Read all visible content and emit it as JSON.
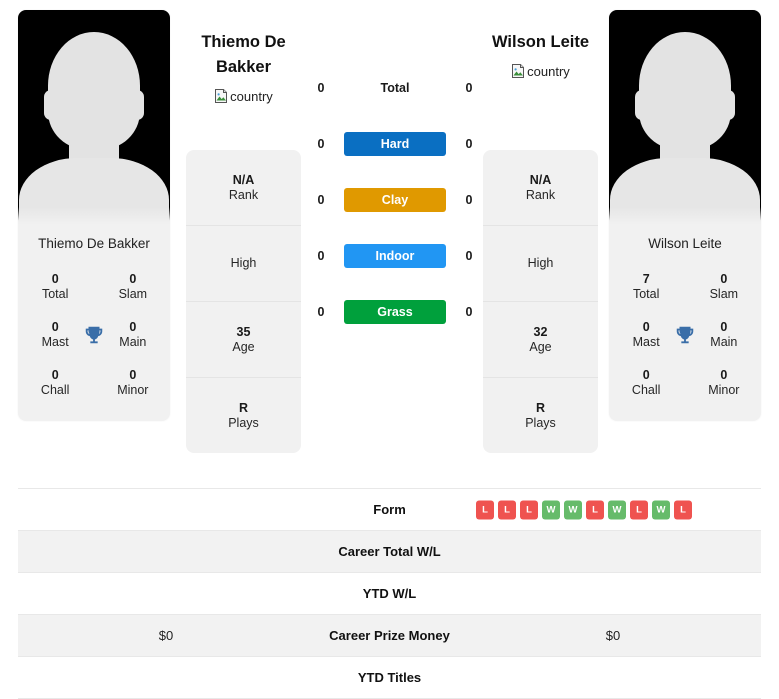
{
  "players": {
    "left": {
      "name": "Thiemo De Bakker",
      "headline": "Thiemo De Bakker",
      "flag_alt": "country",
      "titles": {
        "total_value": "0",
        "total_label": "Total",
        "slam_value": "0",
        "slam_label": "Slam",
        "mast_value": "0",
        "mast_label": "Mast",
        "main_value": "0",
        "main_label": "Main",
        "chall_value": "0",
        "chall_label": "Chall",
        "minor_value": "0",
        "minor_label": "Minor"
      },
      "info": {
        "rank_value": "N/A",
        "rank_label": "Rank",
        "high_value": "",
        "high_label": "High",
        "age_value": "35",
        "age_label": "Age",
        "plays_value": "R",
        "plays_label": "Plays"
      },
      "surfaces": {
        "total": "0",
        "hard": "0",
        "clay": "0",
        "indoor": "0",
        "grass": "0"
      },
      "table": {
        "form": [
          "L",
          "L",
          "L",
          "W",
          "W",
          "L",
          "W",
          "L",
          "W",
          "L"
        ],
        "career_wl": "",
        "ytd_wl": "",
        "career_prize_money": "$0",
        "ytd_titles": ""
      }
    },
    "right": {
      "name": "Wilson Leite",
      "headline": "Wilson Leite",
      "flag_alt": "country",
      "titles": {
        "total_value": "7",
        "total_label": "Total",
        "slam_value": "0",
        "slam_label": "Slam",
        "mast_value": "0",
        "mast_label": "Mast",
        "main_value": "0",
        "main_label": "Main",
        "chall_value": "0",
        "chall_label": "Chall",
        "minor_value": "0",
        "minor_label": "Minor"
      },
      "info": {
        "rank_value": "N/A",
        "rank_label": "Rank",
        "high_value": "",
        "high_label": "High",
        "age_value": "32",
        "age_label": "Age",
        "plays_value": "R",
        "plays_label": "Plays"
      },
      "surfaces": {
        "total": "0",
        "hard": "0",
        "clay": "0",
        "indoor": "0",
        "grass": "0"
      },
      "table": {
        "career_wl": "",
        "ytd_wl": "",
        "career_prize_money": "$0",
        "ytd_titles": ""
      }
    }
  },
  "surface_labels": {
    "total": "Total",
    "hard": "Hard",
    "clay": "Clay",
    "indoor": "Indoor",
    "grass": "Grass"
  },
  "table_labels": {
    "form": "Form",
    "career_wl": "Career Total W/L",
    "ytd_wl": "YTD W/L",
    "career_prize_money": "Career Prize Money",
    "ytd_titles": "YTD Titles"
  },
  "colors": {
    "hard": "#0a6fc2",
    "clay": "#e09900",
    "indoor": "#2196f3",
    "grass": "#00a03c",
    "win": "#66bb6a",
    "loss": "#ef5350",
    "trophy": "#3a6ea8"
  }
}
